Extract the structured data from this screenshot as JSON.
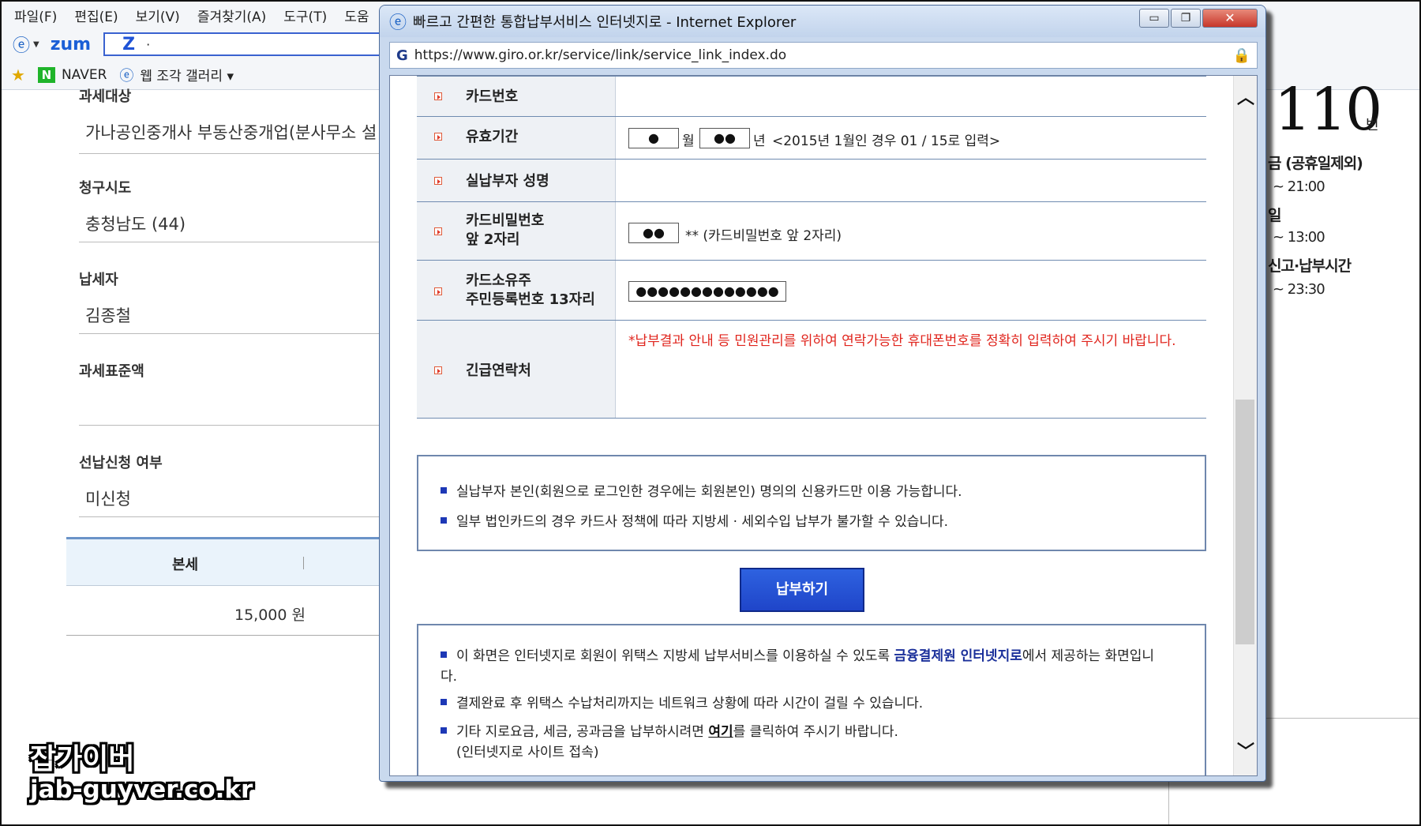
{
  "background": {
    "menu": [
      "파일(F)",
      "편집(E)",
      "보기(V)",
      "즐겨찾기(A)",
      "도구(T)",
      "도움"
    ],
    "toolbar": {
      "logo": "zum",
      "search_letter": "Z",
      "search_caret": "·"
    },
    "favorites": {
      "naver": "NAVER",
      "gallery": "웹 조각 갤러리 ▾"
    },
    "fields": [
      {
        "label": "과세대상",
        "value": "가나공인중개사 부동산중개업(분사무소 설"
      },
      {
        "label": "청구시도",
        "value": "충청남도 (44)"
      },
      {
        "label": "납세자",
        "value": "김종철"
      },
      {
        "label": "과세표준액",
        "value": ""
      },
      {
        "label": "선납신청 여부",
        "value": "미신청"
      }
    ],
    "tax_table": {
      "header": "본세",
      "amount": "15,000 원"
    },
    "right_panel": {
      "number": "110",
      "unit": "번",
      "line1": "금 (공휴일제외)",
      "time1": "~ 21:00",
      "line2": "일",
      "time2": "~ 13:00",
      "line3": "신고·납부시간",
      "time3": "~ 23:30"
    },
    "watermark": {
      "line1": "잡가이버",
      "line2": "jab-guyver.co.kr"
    }
  },
  "popup": {
    "title": "빠르고 간편한 통합납부서비스 인터넷지로 - Internet Explorer",
    "buttons": {
      "minimize": "▭",
      "restore": "❐",
      "close": "✕"
    },
    "url": "https://www.giro.or.kr/service/link/service_link_index.do",
    "form": {
      "card_number": {
        "label": "카드번호"
      },
      "expiry": {
        "label": "유효기간",
        "month_value": "●",
        "month_unit": "월",
        "year_value": "●●",
        "year_unit": "년",
        "hint": "<2015년 1월인 경우 01 / 15로 입력>"
      },
      "payer_name": {
        "label": "실납부자 성명"
      },
      "card_password": {
        "label_line1": "카드비밀번호",
        "label_line2": "앞 2자리",
        "value": "●●",
        "hint": "** (카드비밀번호 앞 2자리)"
      },
      "resident_number": {
        "label_line1": "카드소유주",
        "label_line2": "주민등록번호 13자리",
        "value": "●●●●●●●●●●●●●"
      },
      "emergency_contact": {
        "label": "긴급연락처",
        "notice": "*납부결과 안내 등 민원관리를 위하여 연락가능한 휴대폰번호를 정확히 입력하여 주시기 바랍니다."
      }
    },
    "notices": [
      "실납부자 본인(회원으로 로그인한 경우에는 회원본인) 명의의 신용카드만 이용 가능합니다.",
      "일부 법인카드의 경우 카드사 정책에 따라 지방세 · 세외수입 납부가 불가할 수 있습니다."
    ],
    "pay_button": "납부하기",
    "info": {
      "line1_pre": "이 화면은 인터넷지로 회원이 위택스 지방세 납부서비스를 이용하실 수 있도록 ",
      "line1_blue": "금융결제원 인터넷지로",
      "line1_post": "에서 제공하는 화면입니다.",
      "line2": "결제완료 후 위택스 수납처리까지는 네트워크 상황에 따라 시간이 걸릴 수 있습니다.",
      "line3_pre": "기타 지로요금, 세금, 공과금을 납부하시려면 ",
      "line3_link": "여기",
      "line3_post": "를 클릭하여 주시기 바랍니다.",
      "line3_sub": "(인터넷지로 사이트 접속)"
    },
    "colors": {
      "accent": "#1f45c9",
      "warning": "#e0241c",
      "link_blue": "#1a2f9a"
    }
  }
}
